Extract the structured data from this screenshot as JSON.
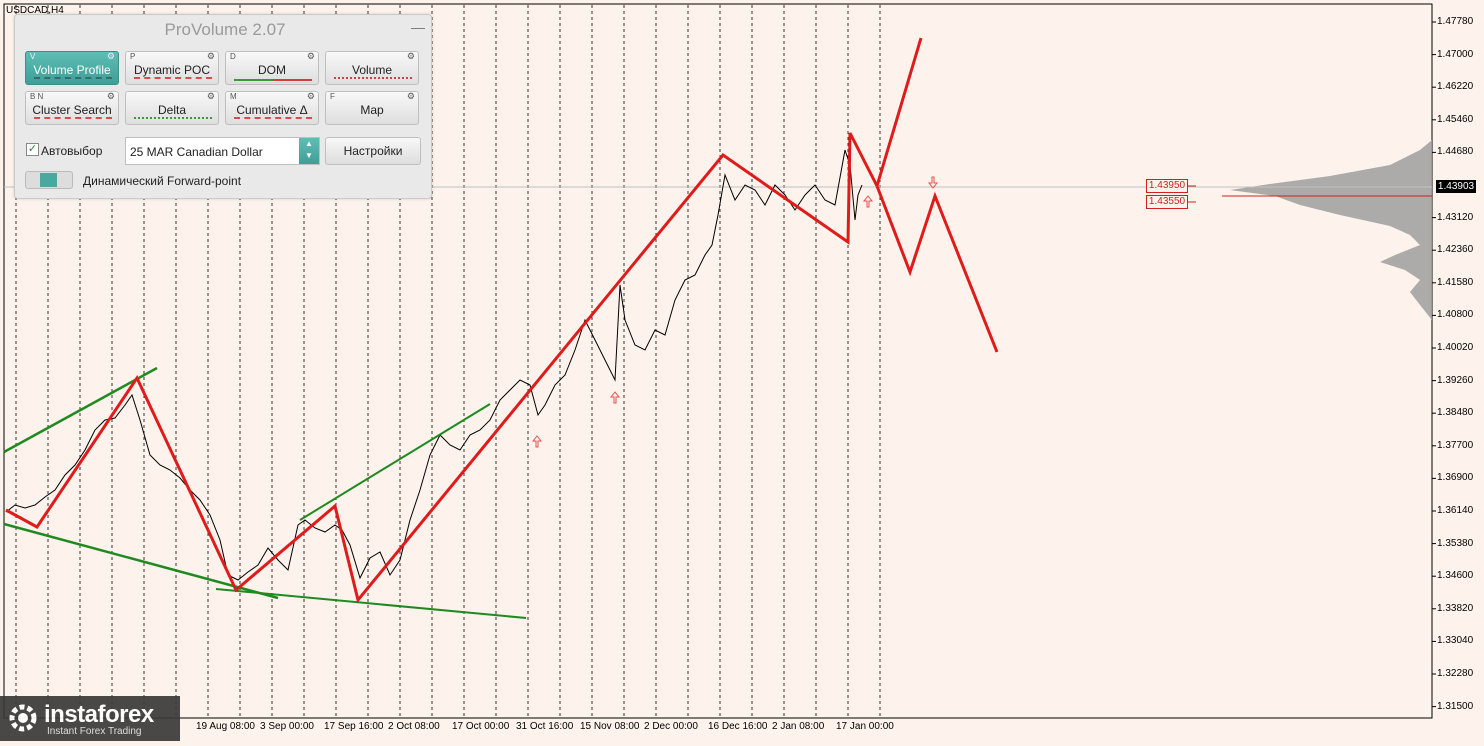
{
  "symbol": "USDCAD,H4",
  "current_price": "1.43903",
  "levels": [
    "1.43950",
    "1.43550"
  ],
  "price_axis": [
    "1.47780",
    "1.47000",
    "1.46220",
    "1.45460",
    "1.44680",
    "1.43903",
    "1.43120",
    "1.42360",
    "1.41580",
    "1.40800",
    "1.40020",
    "1.39260",
    "1.38480",
    "1.37700",
    "1.36900",
    "1.36140",
    "1.35380",
    "1.34600",
    "1.33820",
    "1.33040",
    "1.32280",
    "1.31500"
  ],
  "date_axis": [
    "19 Aug 08:00",
    "3 Sep 00:00",
    "17 Sep 16:00",
    "2 Oct 08:00",
    "17 Oct 00:00",
    "31 Oct 16:00",
    "15 Nov 08:00",
    "2 Dec 00:00",
    "16 Dec 16:00",
    "2 Jan 08:00",
    "17 Jan 00:00"
  ],
  "colors": {
    "bg": "#fdf3ec",
    "accent": "#4aa89f",
    "forecast": "#e01b1b",
    "trend": "#1f8a1f",
    "price": "#000000"
  },
  "panel": {
    "title": "ProVolume 2.07",
    "minimize": "—",
    "buttons": [
      {
        "label": "Volume Profile",
        "hotkey": "V",
        "active": true
      },
      {
        "label": "Dynamic POC",
        "hotkey": "P",
        "active": false
      },
      {
        "label": "DOM",
        "hotkey": "D",
        "active": false
      },
      {
        "label": "Volume",
        "hotkey": "",
        "active": false
      },
      {
        "label": "Cluster Search",
        "hotkey": "B  N",
        "active": false
      },
      {
        "label": "Delta",
        "hotkey": "",
        "active": false
      },
      {
        "label": "Cumulative Δ",
        "hotkey": "M",
        "active": false
      },
      {
        "label": "Map",
        "hotkey": "F",
        "active": false
      }
    ],
    "auto_select_label": "Автовыбор",
    "auto_select_checked": true,
    "contract": "25 MAR Canadian Dollar",
    "settings_label": "Настройки",
    "forward_label": "Динамический Forward-point"
  },
  "logo": {
    "name": "instaforex",
    "tagline": "Instant Forex Trading"
  }
}
